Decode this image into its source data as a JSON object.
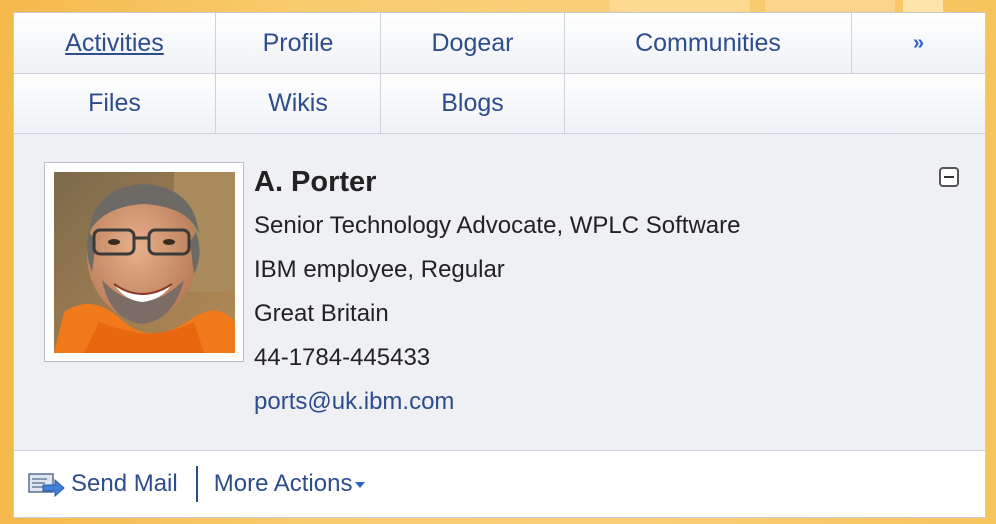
{
  "tabs": {
    "row1": [
      "Activities",
      "Profile",
      "Dogear",
      "Communities"
    ],
    "row2": [
      "Files",
      "Wikis",
      "Blogs"
    ],
    "more_icon": "double-chevron-down-icon"
  },
  "profile": {
    "name": "A. Porter",
    "title": "Senior Technology Advocate, WPLC Software",
    "employment": "IBM employee, Regular",
    "location": "Great Britain",
    "phone": "44-1784-445433",
    "email": "ports@uk.ibm.com"
  },
  "actions": {
    "send_mail": "Send Mail",
    "more_actions": "More Actions"
  },
  "colors": {
    "link": "#2d4d8c",
    "panel_bg": "#eef0f3",
    "page_bg": "#f6c15a"
  }
}
